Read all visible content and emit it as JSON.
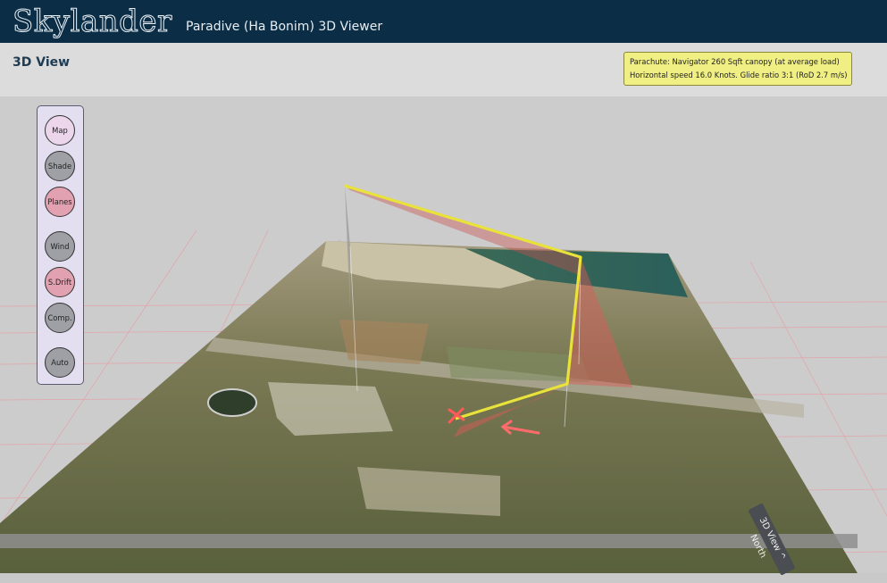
{
  "header": {
    "logo_text": "Skylander",
    "app_title": "Paradive (Ha Bonim) 3D Viewer"
  },
  "view": {
    "title": "3D View"
  },
  "info": {
    "line1": "Parachute: Navigator 260 Sqft canopy (at average load)",
    "line2": "Horizontal speed 16.0 Knots. Glide ratio 3:1 (RoD 2.7 m/s)"
  },
  "toolbar": {
    "map": "Map",
    "shade": "Shade",
    "planes": "Planes",
    "wind": "Wind",
    "sdrift": "S.Drift",
    "comp": "Comp.",
    "auto": "Auto"
  },
  "north_label": "3D View ^ North",
  "colors": {
    "header_bg": "#0b2d45",
    "info_bg": "#f0ef84",
    "path_yellow": "#e8e23a",
    "landing_red": "#ff4d4d",
    "grid_red": "#e99aa0"
  }
}
